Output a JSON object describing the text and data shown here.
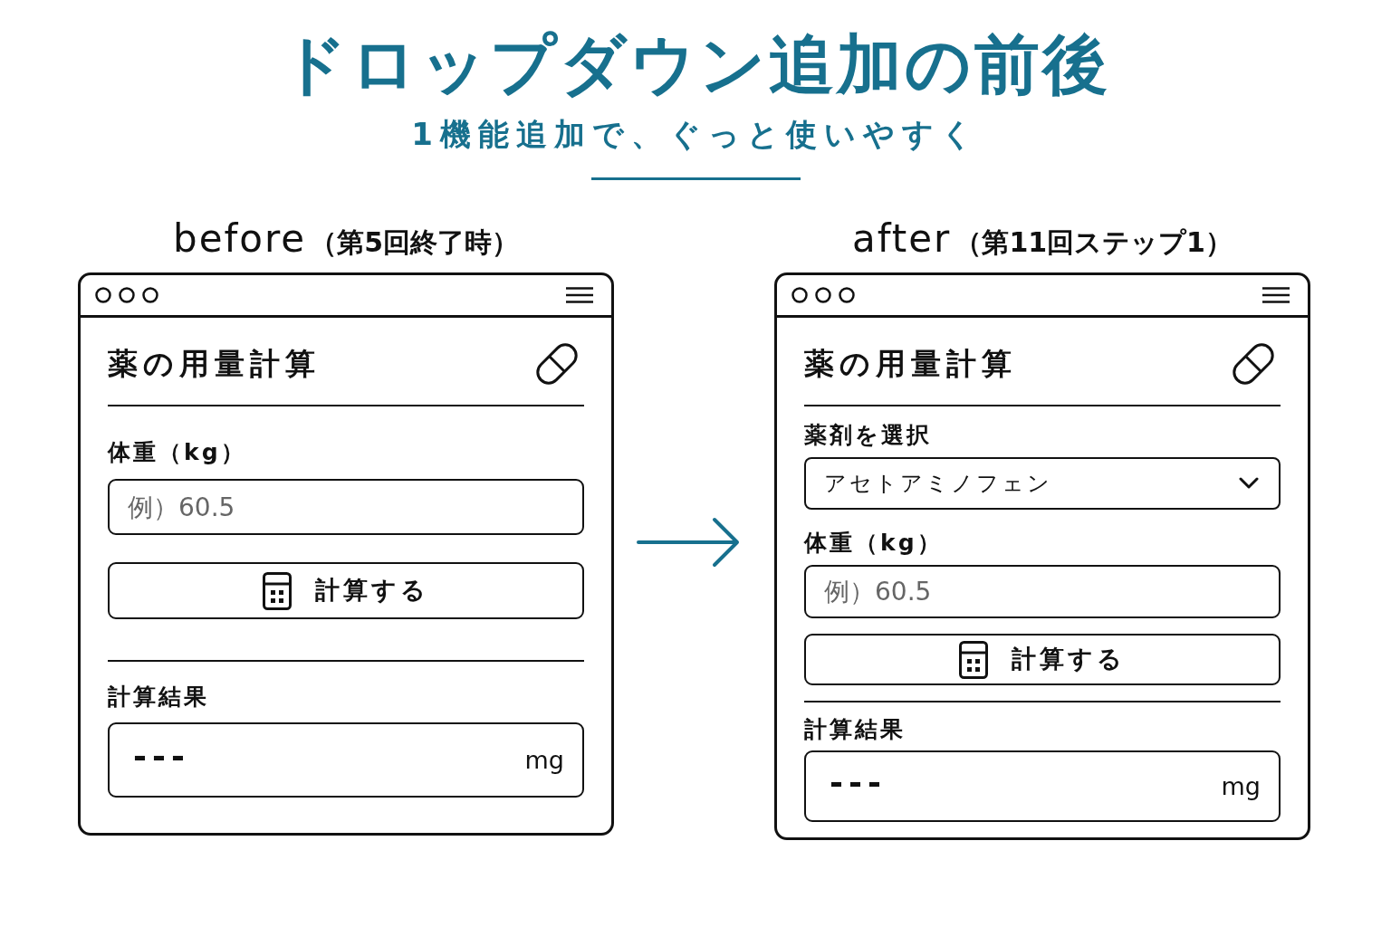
{
  "title": "ドロップダウン追加の前後",
  "subtitle": "1機能追加で、ぐっと使いやすく",
  "panels": [
    {
      "caption": "before",
      "note": "（第5回終了時）",
      "app": {
        "title": "薬の用量計算",
        "fields": [
          {
            "kind": "input",
            "label": "体重（kg）",
            "placeholder": "例）60.5"
          }
        ],
        "button": "計算する",
        "result": {
          "label": "計算結果",
          "value": "---",
          "unit": "mg"
        }
      }
    },
    {
      "caption": "after",
      "note": "（第11回ステップ1）",
      "app": {
        "title": "薬の用量計算",
        "fields": [
          {
            "kind": "select",
            "label": "薬剤を選択",
            "value": "アセトアミノフェン"
          },
          {
            "kind": "input",
            "label": "体重（kg）",
            "placeholder": "例）60.5"
          }
        ],
        "button": "計算する",
        "result": {
          "label": "計算結果",
          "value": "---",
          "unit": "mg"
        }
      }
    }
  ]
}
